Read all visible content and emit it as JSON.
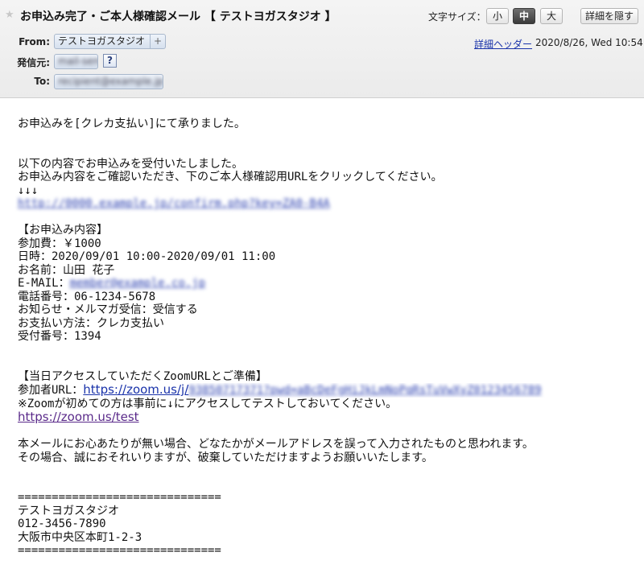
{
  "header": {
    "subject": "お申込み完了・ご本人様確認メール 【 テストヨガスタジオ 】",
    "font_size_label": "文字サイズ：",
    "font_size_options": [
      "小",
      "中",
      "大"
    ],
    "font_size_selected": "中",
    "hide_details_label": "詳細を隠す",
    "from_label": "From:",
    "from_name": "テストヨガスタジオ",
    "from_add": "+",
    "sender_label": "発信元:",
    "sender_value": "mail-sender",
    "help_label": "?",
    "to_label": "To:",
    "to_value": "recipient@example.jp",
    "detail_header_link": "詳細ヘッダー",
    "date": "2020/8/26, Wed 10:54"
  },
  "body": {
    "line1": "お申込みを[クレカ支払い]にて承りました。",
    "line2": "以下の内容でお申込みを受付いたしました。",
    "line3": "お申込み内容をご確認いただき、下のご本人様確認用URLをクリックしてください。",
    "arrows": "↓↓↓",
    "confirm_url": "http://0000.example.jp/confirm.php?key=ZA0-B4A",
    "section1_title": "【お申込み内容】",
    "fee": "参加費：￥1000",
    "datetime": "日時：2020/09/01 10:00-2020/09/01 11:00",
    "name": "お名前：山田 花子",
    "email_label": "E-MAIL：",
    "email_value": "member@example.co.jp",
    "phone": "電話番号：06-1234-5678",
    "newsletter": "お知らせ・メルマガ受信：受信する",
    "payment": "お支払い方法：クレカ支払い",
    "receipt": "受付番号：1394",
    "section2_title": "【当日アクセスしていただくZoomURLとご準備】",
    "participant_label": "参加者URL：",
    "zoom_url_prefix": "https://zoom.us/j/",
    "zoom_url_rest": "93850717371?pwd=aBcDeFgHiJkLmNoPqRsTuVwXyZ0123456789",
    "zoom_note": "※Zoomが初めての方は事前に↓にアクセスしてテストしておいてください。",
    "zoom_test_url": "https://zoom.us/test",
    "notice1": "本メールにお心あたりが無い場合、どなたかがメールアドレスを誤って入力されたものと思われます。",
    "notice2": "その場合、誠におそれいりますが、破棄していただけますようお願いいたします。",
    "divider": "==============================",
    "studio_name": "テストヨガスタジオ",
    "studio_phone": "012-3456-7890",
    "studio_address": "大阪市中央区本町1-2-3"
  }
}
